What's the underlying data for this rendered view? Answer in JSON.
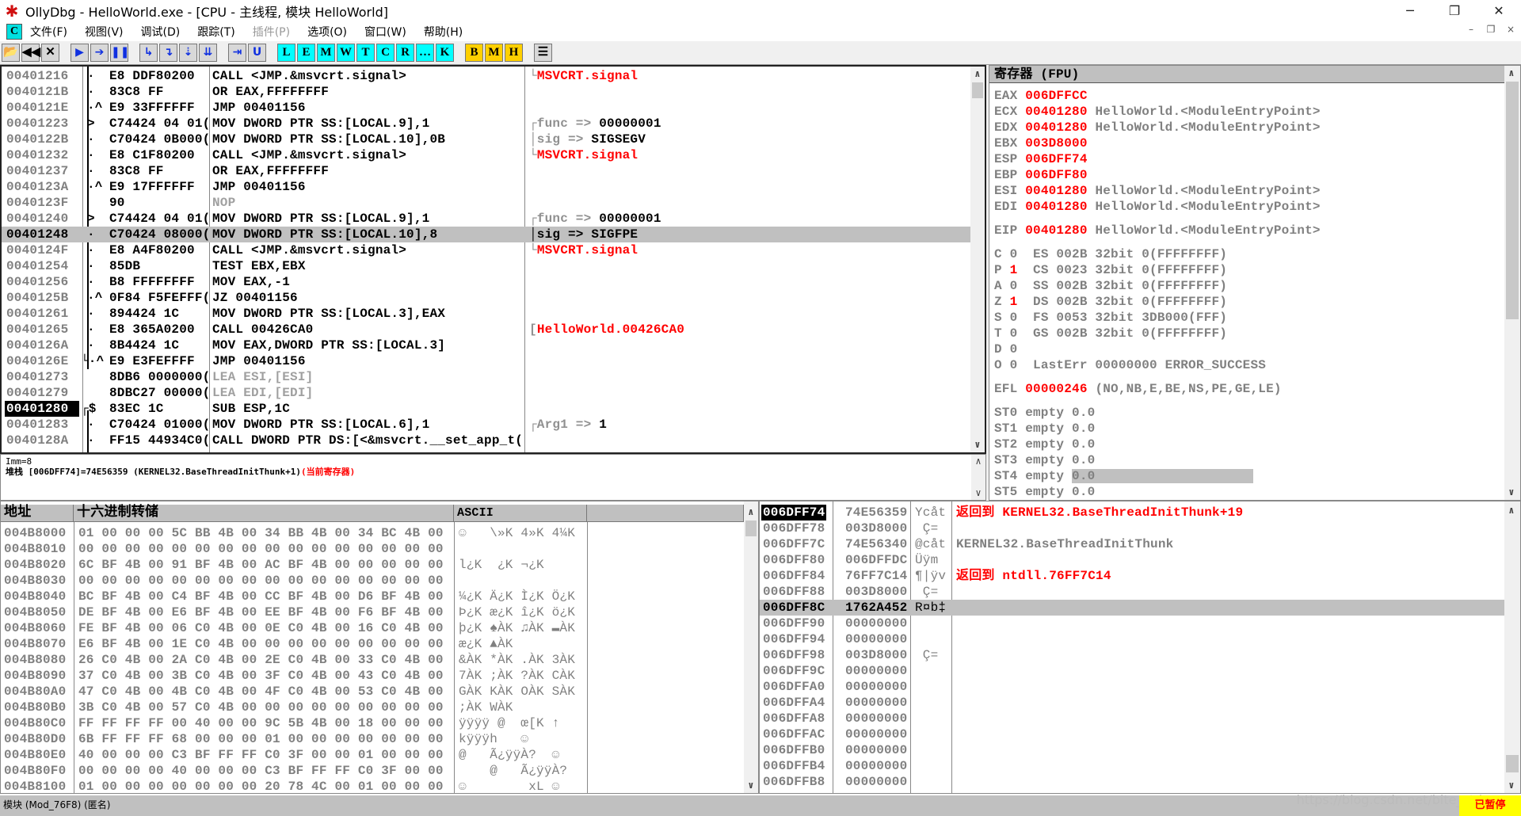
{
  "window": {
    "title": "OllyDbg - HelloWorld.exe - [CPU - 主线程, 模块 HelloWorld]",
    "minimize": "─",
    "restore": "❐",
    "close": "✕"
  },
  "menu": {
    "cpu_icon": "C",
    "items": [
      {
        "label": "文件(F)",
        "enabled": true
      },
      {
        "label": "视图(V)",
        "enabled": true
      },
      {
        "label": "调试(D)",
        "enabled": true
      },
      {
        "label": "跟踪(T)",
        "enabled": true
      },
      {
        "label": "插件(P)",
        "enabled": false
      },
      {
        "label": "选项(O)",
        "enabled": true
      },
      {
        "label": "窗口(W)",
        "enabled": true
      },
      {
        "label": "帮助(H)",
        "enabled": true
      }
    ],
    "mdi": [
      "–",
      "❐",
      "×"
    ]
  },
  "toolbar": {
    "buttons": [
      {
        "name": "open",
        "glyph": "📂",
        "style": "plain"
      },
      {
        "name": "restart",
        "glyph": "◀◀",
        "style": "plain"
      },
      {
        "name": "close",
        "glyph": "✕",
        "style": "plain"
      },
      {
        "name": "run",
        "glyph": "▶",
        "style": "blue"
      },
      {
        "name": "run-thread",
        "glyph": "➔",
        "style": "blue"
      },
      {
        "name": "pause",
        "glyph": "❚❚",
        "style": "blue"
      },
      {
        "name": "step-into",
        "glyph": "↳",
        "style": "blue"
      },
      {
        "name": "step-over",
        "glyph": "↴",
        "style": "blue"
      },
      {
        "name": "trace-into",
        "glyph": "⇣",
        "style": "blue"
      },
      {
        "name": "trace-over",
        "glyph": "⇊",
        "style": "blue"
      },
      {
        "name": "execute-till-return",
        "glyph": "⇥",
        "style": "blue"
      },
      {
        "name": "execute-till-user-code",
        "glyph": "U",
        "style": "blue"
      },
      {
        "name": "log",
        "glyph": "L",
        "style": "cyan"
      },
      {
        "name": "modules",
        "glyph": "E",
        "style": "cyan"
      },
      {
        "name": "memory",
        "glyph": "M",
        "style": "cyan"
      },
      {
        "name": "windows",
        "glyph": "W",
        "style": "cyan"
      },
      {
        "name": "threads",
        "glyph": "T",
        "style": "cyan"
      },
      {
        "name": "cpu",
        "glyph": "C",
        "style": "cyan"
      },
      {
        "name": "references",
        "glyph": "R",
        "style": "cyan"
      },
      {
        "name": "run-trace",
        "glyph": "…",
        "style": "cyan"
      },
      {
        "name": "call-stack",
        "glyph": "K",
        "style": "cyan"
      },
      {
        "name": "breakpoints",
        "glyph": "B",
        "style": "yel"
      },
      {
        "name": "memory-breakpoints",
        "glyph": "M",
        "style": "yel"
      },
      {
        "name": "hardware-breakpoints",
        "glyph": "H",
        "style": "yel"
      },
      {
        "name": "list",
        "glyph": "☰",
        "style": "plain"
      }
    ]
  },
  "disasm": {
    "rows": [
      {
        "addr": "00401216",
        "mark": "·",
        "hex": "E8 DDF80200",
        "cmd": "CALL <JMP.&msvcrt.signal>",
        "c_label": "└",
        "c_value": "MSVCRT.signal",
        "c_color": "#ff0000"
      },
      {
        "addr": "0040121B",
        "mark": "·",
        "hex": "83C8 FF",
        "cmd": "OR EAX,FFFFFFFF"
      },
      {
        "addr": "0040121E",
        "mark": "·^",
        "hex": "E9 33FFFFFF",
        "cmd": "JMP 00401156"
      },
      {
        "addr": "00401223",
        "mark": ">",
        "hex": "C74424 04 01(",
        "cmd": "MOV DWORD PTR SS:[LOCAL.9],1",
        "c_label": "┌func => ",
        "c_value": "00000001",
        "c_color": "#000000"
      },
      {
        "addr": "0040122B",
        "mark": "·",
        "hex": "C70424 0B000(",
        "cmd": "MOV DWORD PTR SS:[LOCAL.10],0B",
        "c_label": "│sig => ",
        "c_value": "SIGSEGV",
        "c_color": "#000000"
      },
      {
        "addr": "00401232",
        "mark": "·",
        "hex": "E8 C1F80200",
        "cmd": "CALL <JMP.&msvcrt.signal>",
        "c_label": "└",
        "c_value": "MSVCRT.signal",
        "c_color": "#ff0000"
      },
      {
        "addr": "00401237",
        "mark": "·",
        "hex": "83C8 FF",
        "cmd": "OR EAX,FFFFFFFF"
      },
      {
        "addr": "0040123A",
        "mark": "·^",
        "hex": "E9 17FFFFFF",
        "cmd": "JMP 00401156"
      },
      {
        "addr": "0040123F",
        "mark": "",
        "hex": "90",
        "cmd": "NOP",
        "dim": true
      },
      {
        "addr": "00401240",
        "mark": ">",
        "hex": "C74424 04 01(",
        "cmd": "MOV DWORD PTR SS:[LOCAL.9],1",
        "c_label": "┌func => ",
        "c_value": "00000001",
        "c_color": "#000000"
      },
      {
        "addr": "00401248",
        "mark": "·",
        "hex": "C70424 08000(",
        "cmd": "MOV DWORD PTR SS:[LOCAL.10],8",
        "c_label": "│sig => ",
        "c_value": "SIGFPE",
        "c_color": "#000000",
        "selected": true
      },
      {
        "addr": "0040124F",
        "mark": "·",
        "hex": "E8 A4F80200",
        "cmd": "CALL <JMP.&msvcrt.signal>",
        "c_label": "└",
        "c_value": "MSVCRT.signal",
        "c_color": "#ff0000"
      },
      {
        "addr": "00401254",
        "mark": "·",
        "hex": "85DB",
        "cmd": "TEST EBX,EBX"
      },
      {
        "addr": "00401256",
        "mark": "·",
        "hex": "B8 FFFFFFFF",
        "cmd": "MOV EAX,-1"
      },
      {
        "addr": "0040125B",
        "mark": "·^",
        "hex": "0F84 F5FEFFF(",
        "cmd": "JZ 00401156"
      },
      {
        "addr": "00401261",
        "mark": "·",
        "hex": "894424 1C",
        "cmd": "MOV DWORD PTR SS:[LOCAL.3],EAX"
      },
      {
        "addr": "00401265",
        "mark": "·",
        "hex": "E8 365A0200",
        "cmd": "CALL 00426CA0",
        "c_label": "[",
        "c_value": "HelloWorld.00426CA0",
        "c_color": "#ff0000"
      },
      {
        "addr": "0040126A",
        "mark": "·",
        "hex": "8B4424 1C",
        "cmd": "MOV EAX,DWORD PTR SS:[LOCAL.3]"
      },
      {
        "addr": "0040126E",
        "mark": "└·^",
        "hex": "E9 E3FEFFFF",
        "cmd": "JMP 00401156"
      },
      {
        "addr": "00401273",
        "mark": "",
        "hex": "8DB6 0000000(",
        "cmd": "LEA ESI,[ESI]",
        "dim": true
      },
      {
        "addr": "00401279",
        "mark": "",
        "hex": "8DBC27 00000(",
        "cmd": "LEA EDI,[EDI]",
        "dim": true
      },
      {
        "addr": "00401280",
        "mark": "┌$",
        "hex": "83EC 1C",
        "cmd": "SUB ESP,1C",
        "eip": true
      },
      {
        "addr": "00401283",
        "mark": "·",
        "hex": "C70424 01000(",
        "cmd": "MOV DWORD PTR SS:[LOCAL.6],1",
        "c_label": "┌Arg1 => ",
        "c_value": "1",
        "c_color": "#000000"
      },
      {
        "addr": "0040128A",
        "mark": "·",
        "hex": "FF15 44934C0(",
        "cmd": "CALL DWORD PTR DS:[<&msvcrt.__set_app_t("
      }
    ]
  },
  "info": {
    "line1": "Imm=8",
    "line2_prefix": "堆栈 [006DFF74]=74E56359 (KERNEL32.BaseThreadInitThunk+1)",
    "line2_note": "(当前寄存器)"
  },
  "registers": {
    "title": "寄存器 (FPU)",
    "groups": [
      [
        [
          {
            "t": "EAX ",
            "c": "#808080"
          },
          {
            "t": "006DFFCC",
            "c": "#ff0000"
          }
        ],
        [
          {
            "t": "ECX ",
            "c": "#808080"
          },
          {
            "t": "00401280",
            "c": "#ff0000"
          },
          {
            "t": " HelloWorld.<ModuleEntryPoint>",
            "c": "#808080"
          }
        ],
        [
          {
            "t": "EDX ",
            "c": "#808080"
          },
          {
            "t": "00401280",
            "c": "#ff0000"
          },
          {
            "t": " HelloWorld.<ModuleEntryPoint>",
            "c": "#808080"
          }
        ],
        [
          {
            "t": "EBX ",
            "c": "#808080"
          },
          {
            "t": "003D8000",
            "c": "#ff0000"
          }
        ],
        [
          {
            "t": "ESP ",
            "c": "#808080"
          },
          {
            "t": "006DFF74",
            "c": "#ff0000"
          }
        ],
        [
          {
            "t": "EBP ",
            "c": "#808080"
          },
          {
            "t": "006DFF80",
            "c": "#ff0000"
          }
        ],
        [
          {
            "t": "ESI ",
            "c": "#808080"
          },
          {
            "t": "00401280",
            "c": "#ff0000"
          },
          {
            "t": " HelloWorld.<ModuleEntryPoint>",
            "c": "#808080"
          }
        ],
        [
          {
            "t": "EDI ",
            "c": "#808080"
          },
          {
            "t": "00401280",
            "c": "#ff0000"
          },
          {
            "t": " HelloWorld.<ModuleEntryPoint>",
            "c": "#808080"
          }
        ]
      ],
      [
        [
          {
            "t": "EIP ",
            "c": "#808080"
          },
          {
            "t": "00401280",
            "c": "#ff0000"
          },
          {
            "t": " HelloWorld.<ModuleEntryPoint>",
            "c": "#808080"
          }
        ]
      ],
      [
        [
          {
            "t": "C ",
            "c": "#808080"
          },
          {
            "t": "0",
            "c": "#808080"
          },
          {
            "t": "  ES 002B 32bit 0(FFFFFFFF)",
            "c": "#808080"
          }
        ],
        [
          {
            "t": "P ",
            "c": "#808080"
          },
          {
            "t": "1",
            "c": "#ff0000"
          },
          {
            "t": "  CS 0023 32bit 0(FFFFFFFF)",
            "c": "#808080"
          }
        ],
        [
          {
            "t": "A ",
            "c": "#808080"
          },
          {
            "t": "0",
            "c": "#808080"
          },
          {
            "t": "  SS 002B 32bit 0(FFFFFFFF)",
            "c": "#808080"
          }
        ],
        [
          {
            "t": "Z ",
            "c": "#808080"
          },
          {
            "t": "1",
            "c": "#ff0000"
          },
          {
            "t": "  DS 002B 32bit 0(FFFFFFFF)",
            "c": "#808080"
          }
        ],
        [
          {
            "t": "S ",
            "c": "#808080"
          },
          {
            "t": "0",
            "c": "#808080"
          },
          {
            "t": "  FS 0053 32bit 3DB000(FFF)",
            "c": "#808080"
          }
        ],
        [
          {
            "t": "T ",
            "c": "#808080"
          },
          {
            "t": "0",
            "c": "#808080"
          },
          {
            "t": "  GS 002B 32bit 0(FFFFFFFF)",
            "c": "#808080"
          }
        ],
        [
          {
            "t": "D ",
            "c": "#808080"
          },
          {
            "t": "0",
            "c": "#808080"
          }
        ],
        [
          {
            "t": "O ",
            "c": "#808080"
          },
          {
            "t": "0",
            "c": "#808080"
          },
          {
            "t": "  LastErr 00000000 ERROR_SUCCESS",
            "c": "#808080"
          }
        ]
      ],
      [
        [
          {
            "t": "EFL ",
            "c": "#808080"
          },
          {
            "t": "00000246",
            "c": "#ff0000"
          },
          {
            "t": " (NO,NB,E,BE,NS,PE,GE,LE)",
            "c": "#808080"
          }
        ]
      ],
      [
        [
          {
            "t": "ST0 empty ",
            "c": "#808080"
          },
          {
            "t": "0.0",
            "c": "#808080"
          }
        ],
        [
          {
            "t": "ST1 empty ",
            "c": "#808080"
          },
          {
            "t": "0.0",
            "c": "#808080"
          }
        ],
        [
          {
            "t": "ST2 empty ",
            "c": "#808080"
          },
          {
            "t": "0.0",
            "c": "#808080"
          }
        ],
        [
          {
            "t": "ST3 empty ",
            "c": "#808080"
          },
          {
            "t": "0.0",
            "c": "#808080"
          }
        ],
        [
          {
            "t": "ST4 empty ",
            "c": "#808080"
          },
          {
            "t": "0.0",
            "c": "#808080",
            "hl": true
          }
        ],
        [
          {
            "t": "ST5 empty ",
            "c": "#808080"
          },
          {
            "t": "0.0",
            "c": "#808080"
          }
        ]
      ]
    ]
  },
  "dump": {
    "headers": {
      "address": "地址",
      "hex": "十六进制转储",
      "ascii": "ASCII"
    },
    "rows": [
      {
        "addr": "004B8000",
        "hex": "01 00 00 00 5C BB 4B 00 34 BB 4B 00 34 BC 4B 00",
        "ascii": "☺   \\»K 4»K 4¼K"
      },
      {
        "addr": "004B8010",
        "hex": "00 00 00 00 00 00 00 00 00 00 00 00 00 00 00 00",
        "ascii": ""
      },
      {
        "addr": "004B8020",
        "hex": "6C BF 4B 00 91 BF 4B 00 AC BF 4B 00 00 00 00 00",
        "ascii": "l¿K  ¿K ¬¿K"
      },
      {
        "addr": "004B8030",
        "hex": "00 00 00 00 00 00 00 00 00 00 00 00 00 00 00 00",
        "ascii": ""
      },
      {
        "addr": "004B8040",
        "hex": "BC BF 4B 00 C4 BF 4B 00 CC BF 4B 00 D6 BF 4B 00",
        "ascii": "¼¿K Ä¿K Ì¿K Ö¿K"
      },
      {
        "addr": "004B8050",
        "hex": "DE BF 4B 00 E6 BF 4B 00 EE BF 4B 00 F6 BF 4B 00",
        "ascii": "Þ¿K æ¿K î¿K ö¿K"
      },
      {
        "addr": "004B8060",
        "hex": "FE BF 4B 00 06 C0 4B 00 0E C0 4B 00 16 C0 4B 00",
        "ascii": "þ¿K ♠ÀK ♫ÀK ▬ÀK"
      },
      {
        "addr": "004B8070",
        "hex": "E6 BF 4B 00 1E C0 4B 00 00 00 00 00 00 00 00 00",
        "ascii": "æ¿K ▲ÀK"
      },
      {
        "addr": "004B8080",
        "hex": "26 C0 4B 00 2A C0 4B 00 2E C0 4B 00 33 C0 4B 00",
        "ascii": "&ÀK *ÀK .ÀK 3ÀK"
      },
      {
        "addr": "004B8090",
        "hex": "37 C0 4B 00 3B C0 4B 00 3F C0 4B 00 43 C0 4B 00",
        "ascii": "7ÀK ;ÀK ?ÀK CÀK"
      },
      {
        "addr": "004B80A0",
        "hex": "47 C0 4B 00 4B C0 4B 00 4F C0 4B 00 53 C0 4B 00",
        "ascii": "GÀK KÀK OÀK SÀK"
      },
      {
        "addr": "004B80B0",
        "hex": "3B C0 4B 00 57 C0 4B 00 00 00 00 00 00 00 00 00",
        "ascii": ";ÀK WÀK"
      },
      {
        "addr": "004B80C0",
        "hex": "FF FF FF FF 00 40 00 00 9C 5B 4B 00 18 00 00 00",
        "ascii": "ÿÿÿÿ @  œ[K ↑"
      },
      {
        "addr": "004B80D0",
        "hex": "6B FF FF FF 68 00 00 00 01 00 00 00 00 00 00 00",
        "ascii": "kÿÿÿh   ☺"
      },
      {
        "addr": "004B80E0",
        "hex": "40 00 00 00 C3 BF FF FF C0 3F 00 00 01 00 00 00",
        "ascii": "@   Ã¿ÿÿÀ?  ☺"
      },
      {
        "addr": "004B80F0",
        "hex": "00 00 00 00 40 00 00 00 C3 BF FF FF C0 3F 00 00",
        "ascii": "    @   Ã¿ÿÿÀ?"
      },
      {
        "addr": "004B8100",
        "hex": "01 00 00 00 00 00 00 00 20 78 4C 00 01 00 00 00",
        "ascii": "☺        xL ☺"
      }
    ]
  },
  "stack": {
    "rows": [
      {
        "addr": "006DFF74",
        "value": "74E56359",
        "ascii": "Ycåt",
        "comment": "返回到 KERNEL32.BaseThreadInitThunk+19",
        "c_color": "#ff0000",
        "top": true
      },
      {
        "addr": "006DFF78",
        "value": "003D8000",
        "ascii": " Ç=",
        "comment": ""
      },
      {
        "addr": "006DFF7C",
        "value": "74E56340",
        "ascii": "@cåt",
        "comment": "KERNEL32.BaseThreadInitThunk",
        "c_color": "#808080"
      },
      {
        "addr": "006DFF80",
        "value": "006DFFDC",
        "ascii": "Üÿm",
        "comment": ""
      },
      {
        "addr": "006DFF84",
        "value": "76FF7C14",
        "ascii": "¶|ÿv",
        "comment": "返回到 ntdll.76FF7C14",
        "c_color": "#ff0000"
      },
      {
        "addr": "006DFF88",
        "value": "003D8000",
        "ascii": " Ç=",
        "comment": ""
      },
      {
        "addr": "006DFF8C",
        "value": "1762A452",
        "ascii": "R¤b‡",
        "comment": "",
        "selected": true
      },
      {
        "addr": "006DFF90",
        "value": "00000000",
        "ascii": "",
        "comment": ""
      },
      {
        "addr": "006DFF94",
        "value": "00000000",
        "ascii": "",
        "comment": ""
      },
      {
        "addr": "006DFF98",
        "value": "003D8000",
        "ascii": " Ç=",
        "comment": ""
      },
      {
        "addr": "006DFF9C",
        "value": "00000000",
        "ascii": "",
        "comment": ""
      },
      {
        "addr": "006DFFA0",
        "value": "00000000",
        "ascii": "",
        "comment": ""
      },
      {
        "addr": "006DFFA4",
        "value": "00000000",
        "ascii": "",
        "comment": ""
      },
      {
        "addr": "006DFFA8",
        "value": "00000000",
        "ascii": "",
        "comment": ""
      },
      {
        "addr": "006DFFAC",
        "value": "00000000",
        "ascii": "",
        "comment": ""
      },
      {
        "addr": "006DFFB0",
        "value": "00000000",
        "ascii": "",
        "comment": ""
      },
      {
        "addr": "006DFFB4",
        "value": "00000000",
        "ascii": "",
        "comment": ""
      },
      {
        "addr": "006DFFB8",
        "value": "00000000",
        "ascii": "",
        "comment": ""
      }
    ]
  },
  "status": {
    "text": "模块 (Mod_76F8) (匿名)",
    "state": "已暂停",
    "watermark": "https://blog.csdn.net/bite_stdc"
  }
}
